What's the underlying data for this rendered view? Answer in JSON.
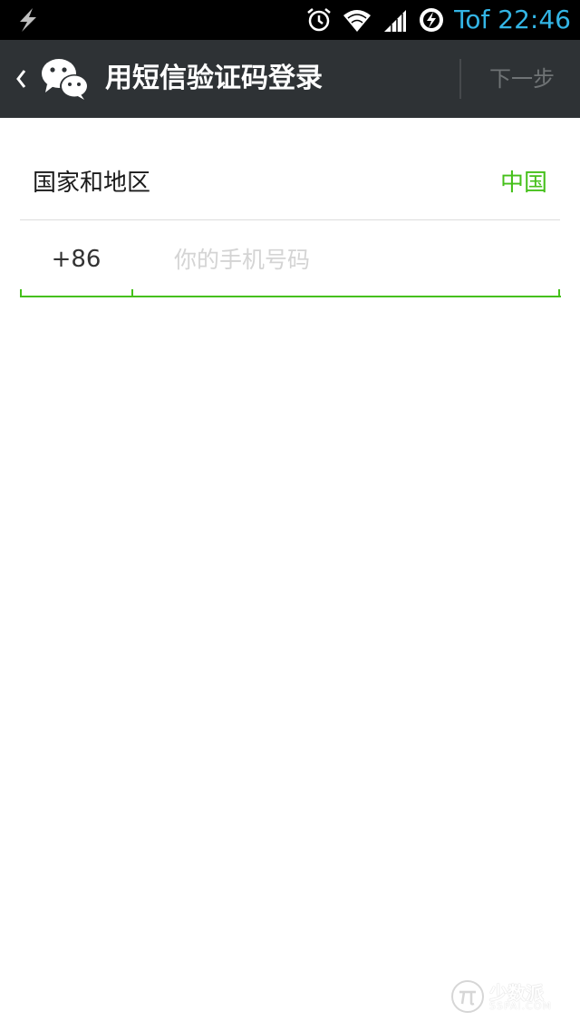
{
  "status_bar": {
    "left_icon": "flash-charging-icon",
    "icons": [
      "alarm-clock-icon",
      "wifi-icon",
      "cellular-signal-icon",
      "power-saver-icon"
    ],
    "carrier_and_time": "Tof 22:46",
    "time_color": "#33b5e5"
  },
  "header": {
    "back_icon": "chevron-left-icon",
    "logo_icon": "wechat-logo-icon",
    "title": "用短信验证码登录",
    "next_label": "下一步",
    "background": "#2e3235"
  },
  "form": {
    "country_label": "国家和地区",
    "country_value": "中国",
    "country_code": "+86",
    "phone_placeholder": "你的手机号码",
    "phone_value": "",
    "accent_color": "#45c01a"
  },
  "watermark": {
    "brand": "少数派",
    "domain": "SSPAI.COM"
  }
}
